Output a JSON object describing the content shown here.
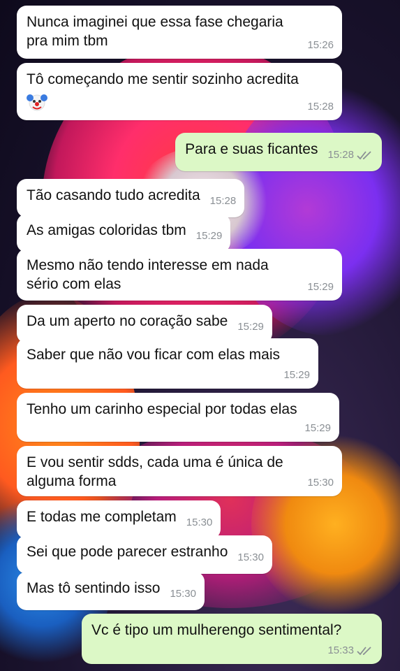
{
  "messages": [
    {
      "dir": "in",
      "text": "Nunca imaginei que essa fase chegaria\npra mim tbm",
      "time": "15:26"
    },
    {
      "dir": "in",
      "text": "Tô começando me sentir sozinho acredita",
      "emoji": "clown-face",
      "time": "15:28"
    },
    {
      "dir": "out",
      "text": "Para e suas ficantes",
      "time": "15:28",
      "status": "read-double-check"
    },
    {
      "dir": "in",
      "text": "Tão casando tudo acredita",
      "time": "15:28"
    },
    {
      "dir": "in",
      "text": "As amigas coloridas tbm",
      "time": "15:29"
    },
    {
      "dir": "in",
      "text": "Mesmo não tendo interesse em nada\nsério com elas",
      "time": "15:29"
    },
    {
      "dir": "in",
      "text": "Da um aperto no coração sabe",
      "time": "15:29"
    },
    {
      "dir": "in",
      "text": "Saber que não vou ficar com elas mais",
      "time": "15:29"
    },
    {
      "dir": "in",
      "text": "Tenho um carinho especial por todas elas",
      "time": "15:29"
    },
    {
      "dir": "in",
      "text": "E vou sentir sdds, cada uma é única de\nalguma forma",
      "time": "15:30"
    },
    {
      "dir": "in",
      "text": "E todas me completam",
      "time": "15:30"
    },
    {
      "dir": "in",
      "text": "Sei que pode parecer estranho",
      "time": "15:30"
    },
    {
      "dir": "in",
      "text": "Mas tô sentindo isso",
      "time": "15:30"
    },
    {
      "dir": "out",
      "text": "Vc é tipo um mulherengo sentimental?",
      "time": "15:33",
      "status": "read-double-check"
    }
  ],
  "colors": {
    "incoming_bubble": "#ffffff",
    "outgoing_bubble": "#dcf8c6",
    "timestamp": "#8a8f94",
    "read_check": "#8a8f94"
  }
}
